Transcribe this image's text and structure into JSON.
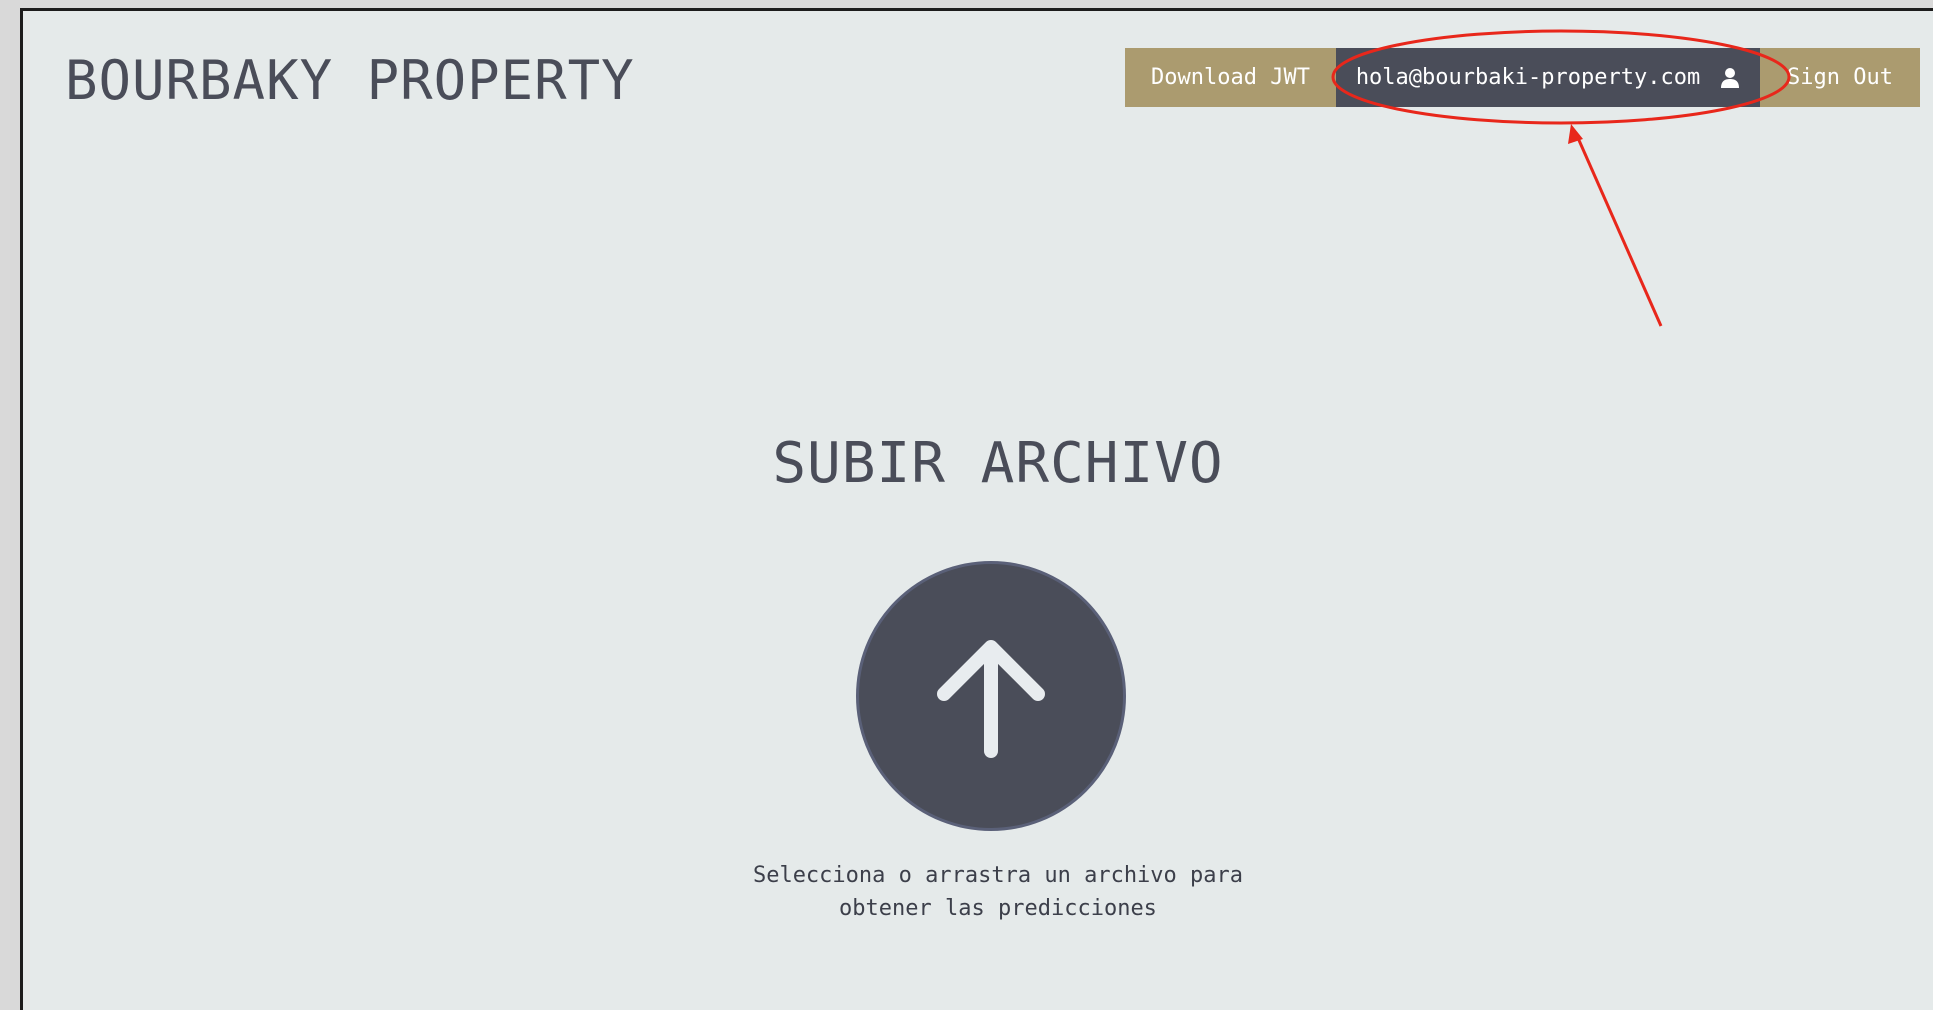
{
  "header": {
    "logo": "BOURBAKY PROPERTY",
    "nav": {
      "download_jwt": "Download JWT",
      "user_email": "hola@bourbaki-property.com",
      "user_icon": "person-icon",
      "sign_out": "Sign Out"
    }
  },
  "main": {
    "title": "SUBIR ARCHIVO",
    "upload_icon": "arrow-up-icon",
    "hint_line1": "Selecciona o arrastra un archivo para",
    "hint_line2": "obtener las predicciones"
  },
  "colors": {
    "background": "#e5eaea",
    "primary_dark": "#4a4d59",
    "accent_gold": "#ab9b6f",
    "annotation_red": "#e8271b"
  }
}
